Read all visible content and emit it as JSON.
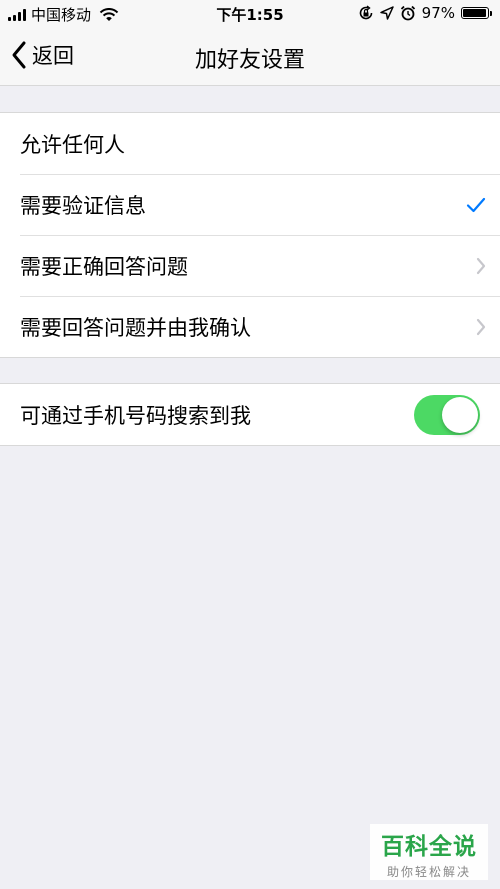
{
  "status_bar": {
    "carrier": "中国移动",
    "time": "下午1:55",
    "battery": "97%",
    "battery_level": 0.97,
    "icons": [
      "signal-icon",
      "wifi-icon",
      "orientation-lock-icon",
      "location-icon",
      "alarm-icon",
      "battery-icon"
    ]
  },
  "nav": {
    "back_label": "返回",
    "title": "加好友设置"
  },
  "verification_options": [
    {
      "label": "允许任何人",
      "accessory": "none"
    },
    {
      "label": "需要验证信息",
      "accessory": "check"
    },
    {
      "label": "需要正确回答问题",
      "accessory": "chevron"
    },
    {
      "label": "需要回答问题并由我确认",
      "accessory": "chevron"
    }
  ],
  "phone_search": {
    "label": "可通过手机号码搜索到我",
    "enabled": true
  },
  "colors": {
    "accent": "#007aff",
    "toggle_on": "#4cd964",
    "background": "#efeff4"
  },
  "watermark": {
    "main": "百科全说",
    "sub": "助你轻松解决"
  }
}
